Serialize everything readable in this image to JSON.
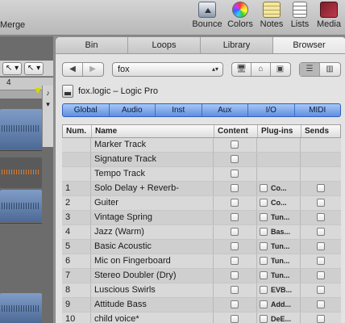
{
  "toolbar": {
    "merge_label": "Merge",
    "items": [
      {
        "label": "Bounce",
        "icon": "bounce-icon"
      },
      {
        "label": "Colors",
        "icon": "colors-icon"
      },
      {
        "label": "Notes",
        "icon": "notes-icon"
      },
      {
        "label": "Lists",
        "icon": "lists-icon"
      },
      {
        "label": "Media",
        "icon": "media-icon"
      }
    ]
  },
  "arrange": {
    "ruler_number": "4",
    "pointer_tool": "↖ ▾",
    "secondary_tool": "↖ ▾",
    "side_arrows": [
      "♪",
      "▾"
    ]
  },
  "browser": {
    "tabs": [
      {
        "label": "Bin",
        "active": false
      },
      {
        "label": "Loops",
        "active": false
      },
      {
        "label": "Library",
        "active": false
      },
      {
        "label": "Browser",
        "active": true
      }
    ],
    "nav": {
      "back": "◀",
      "forward": "▶",
      "location": "fox",
      "location_arrow": "▴▾",
      "view_list": "☰",
      "view_columns": "▥"
    },
    "path": "fox.logic – Logic Pro",
    "filters": [
      "Global",
      "Audio",
      "Inst",
      "Aux",
      "I/O",
      "MIDI"
    ],
    "columns": {
      "num": "Num.",
      "name": "Name",
      "content": "Content",
      "plugins": "Plug-ins",
      "sends": "Sends"
    },
    "rows": [
      {
        "num": "",
        "name": "Marker Track",
        "content": true,
        "plugin": null,
        "sends": false
      },
      {
        "num": "",
        "name": "Signature Track",
        "content": true,
        "plugin": null,
        "sends": false
      },
      {
        "num": "",
        "name": "Tempo Track",
        "content": true,
        "plugin": null,
        "sends": false
      },
      {
        "num": "1",
        "name": "Solo Delay + Reverb-",
        "content": true,
        "plugin": "Co...",
        "sends": true
      },
      {
        "num": "2",
        "name": "Guiter",
        "content": true,
        "plugin": "Co...",
        "sends": true
      },
      {
        "num": "3",
        "name": "Vintage Spring",
        "content": true,
        "plugin": "Tun...",
        "sends": true
      },
      {
        "num": "4",
        "name": "Jazz (Warm)",
        "content": true,
        "plugin": "Bas...",
        "sends": true
      },
      {
        "num": "5",
        "name": "Basic Acoustic",
        "content": true,
        "plugin": "Tun...",
        "sends": true
      },
      {
        "num": "6",
        "name": "Mic on Fingerboard",
        "content": true,
        "plugin": "Tun...",
        "sends": true
      },
      {
        "num": "7",
        "name": "Stereo Doubler (Dry)",
        "content": true,
        "plugin": "Tun...",
        "sends": true
      },
      {
        "num": "8",
        "name": "Luscious Swirls",
        "content": true,
        "plugin": "EVB...",
        "sends": true
      },
      {
        "num": "9",
        "name": "Attitude Bass",
        "content": true,
        "plugin": "Add...",
        "sends": true
      },
      {
        "num": "10",
        "name": "child voice*",
        "content": true,
        "plugin": "DeE...",
        "sends": true
      }
    ]
  }
}
